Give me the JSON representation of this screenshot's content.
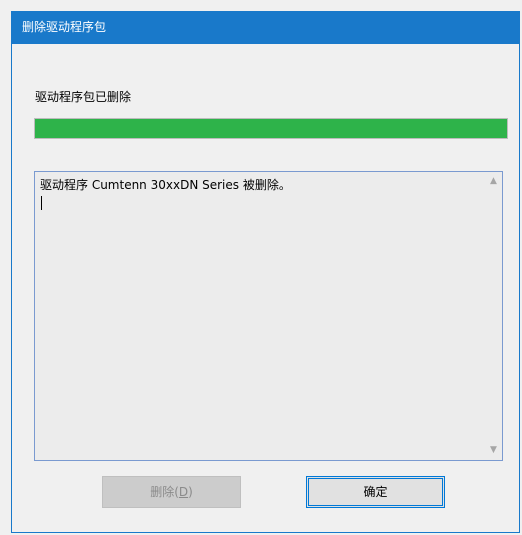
{
  "window": {
    "title": "删除驱动程序包"
  },
  "status_text": "驱动程序包已删除",
  "progress": {
    "percent": 100,
    "color": "#2eb34a"
  },
  "log": {
    "lines": [
      "驱动程序 Cumtenn 30xxDN Series 被删除。"
    ],
    "scroll_up_icon": "chevron-up-icon",
    "scroll_down_icon": "chevron-down-icon"
  },
  "buttons": {
    "delete": {
      "label_prefix": "删除(",
      "mnemonic": "D",
      "label_suffix": ")",
      "enabled": false
    },
    "ok": {
      "label": "确定"
    }
  },
  "colors": {
    "titlebar": "#1979ca",
    "default_button_border": "#0078d7"
  }
}
